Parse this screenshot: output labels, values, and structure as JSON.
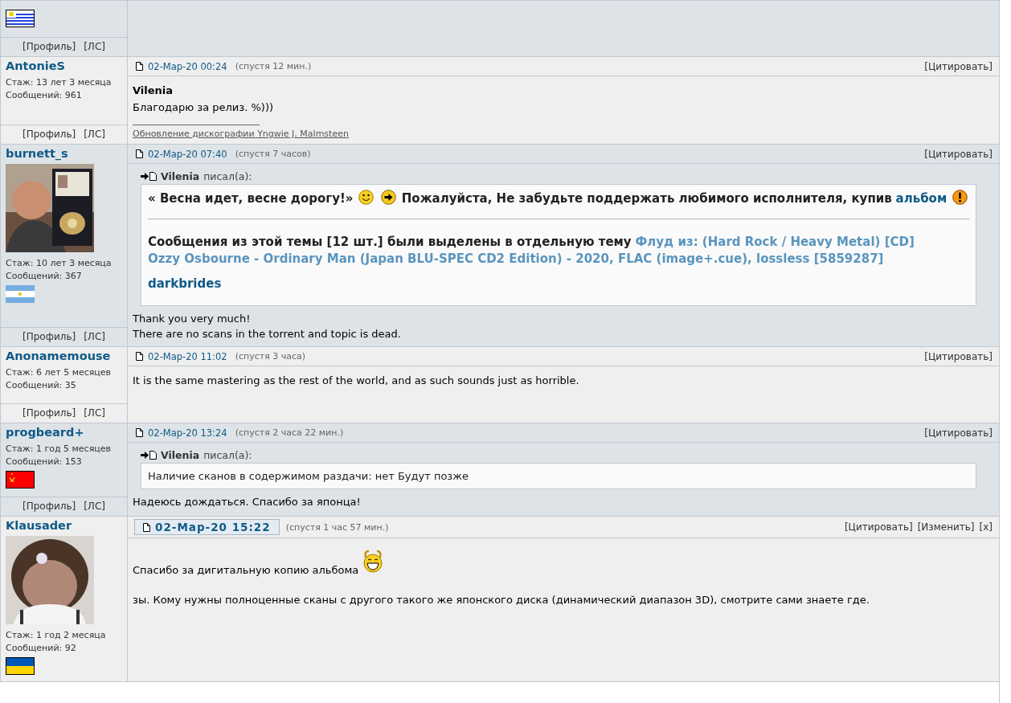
{
  "posts": [
    {
      "flag": {
        "kind": "uruguay"
      },
      "links": [
        "[Профиль]",
        "[ЛС]"
      ]
    },
    {
      "highlighted": false,
      "name": "AntonieS",
      "stats": [
        "Стаж: 13 лет 3 месяца",
        "Сообщений: 961"
      ],
      "links": [
        "[Профиль]",
        "[ЛС]"
      ],
      "date": "02-Мар-20 00:24",
      "after": "(спустя 12 мин.)",
      "actions": [
        "[Цитировать]"
      ],
      "body": [
        {
          "kind": "para",
          "parts": [
            {
              "kind": "strong",
              "text": "Vilenia"
            }
          ]
        },
        {
          "kind": "para",
          "parts": [
            {
              "kind": "text",
              "text": "Благодарю за релиз. %)))"
            }
          ]
        },
        {
          "kind": "signature",
          "text": "Обновление дискографии Yngwie J. Malmsteen"
        }
      ]
    },
    {
      "highlighted": false,
      "name": "burnett_s",
      "avatar": {
        "kind": "picture"
      },
      "stats": [
        "Стаж: 10 лет 3 месяца",
        "Сообщений: 367"
      ],
      "flag": {
        "kind": "argentina"
      },
      "links": [
        "[Профиль]",
        "[ЛС]"
      ],
      "date": "02-Мар-20 07:40",
      "after": "(спустя 7 часов)",
      "actions": [
        "[Цитировать]"
      ],
      "body": [
        {
          "kind": "quote",
          "author": "Vilenia",
          "wrote": "писал(а):",
          "blocks": [
            {
              "kind": "para",
              "parts": [
                {
                  "kind": "strong",
                  "text": "« Весна идет, весне дорогу!»"
                },
                {
                  "kind": "smiley"
                },
                {
                  "kind": "arrow"
                },
                {
                  "kind": "strong",
                  "text": "Пожалуйста, Не забудьте поддержать любимого исполнителя, купив"
                },
                {
                  "kind": "link",
                  "text": "альбом"
                },
                {
                  "kind": "warning"
                }
              ]
            },
            {
              "kind": "rule"
            },
            {
              "kind": "para",
              "parts": [
                {
                  "kind": "strong",
                  "text": "Сообщения из этой темы [12 шт.] были выделены в отдельную тему"
                },
                {
                  "kind": "topic",
                  "lines": [
                    "Флуд из: (Hard Rock / Heavy Metal) [CD]",
                    "Ozzy Osbourne - Ordinary Man (Japan BLU-SPEC CD2 Edition) - 2020, FLAC (image+.cue), lossless [5859287]"
                  ]
                }
              ]
            },
            {
              "kind": "para",
              "parts": [
                {
                  "kind": "link-strong",
                  "text": "darkbrides"
                }
              ]
            }
          ]
        },
        {
          "kind": "line",
          "parts": [
            {
              "kind": "text",
              "text": "Thank you very much!"
            }
          ]
        },
        {
          "kind": "line",
          "parts": [
            {
              "kind": "text",
              "text": "There are no scans in the torrent and topic is dead."
            }
          ]
        }
      ]
    },
    {
      "highlighted": false,
      "name": "Anonamemouse",
      "stats": [
        "Стаж: 6 лет 5 месяцев",
        "Сообщений: 35"
      ],
      "links": [
        "[Профиль]",
        "[ЛС]"
      ],
      "date": "02-Мар-20 11:02",
      "after": "(спустя 3 часа)",
      "actions": [
        "[Цитировать]"
      ],
      "body": [
        {
          "kind": "para",
          "parts": [
            {
              "kind": "text",
              "text": "It is the same mastering as the rest of the world, and as such sounds just as horrible."
            }
          ]
        }
      ]
    },
    {
      "highlighted": false,
      "name": "progbeard+",
      "stats": [
        "Стаж: 1 год 5 месяцев",
        "Сообщений: 153"
      ],
      "flag": {
        "kind": "ussr"
      },
      "links": [
        "[Профиль]",
        "[ЛС]"
      ],
      "date": "02-Мар-20 13:24",
      "after": "(спустя 2 часа 22 мин.)",
      "actions": [
        "[Цитировать]"
      ],
      "body": [
        {
          "kind": "quote",
          "author": "Vilenia",
          "wrote": "писал(а):",
          "blocks": [
            {
              "kind": "line",
              "parts": [
                {
                  "kind": "text",
                  "text": "Наличие сканов в содержимом раздачи: нет Будут позже"
                }
              ]
            }
          ]
        },
        {
          "kind": "para",
          "parts": [
            {
              "kind": "text",
              "text": "Надеюсь дождаться. Спасибо за японца!"
            }
          ]
        }
      ]
    },
    {
      "highlighted": true,
      "name": "Klausader",
      "avatar": {
        "kind": "picture"
      },
      "stats": [
        "Стаж: 1 год 2 месяца",
        "Сообщений: 92"
      ],
      "flag": {
        "kind": "ukraine"
      },
      "date": "02-Мар-20 15:22",
      "after": "(спустя 1 час 57 мин.)",
      "actions": [
        "[Цитировать]",
        "[Изменить]",
        "[x]"
      ],
      "body": [
        {
          "kind": "para",
          "parts": [
            {
              "kind": "text",
              "text": "Спасибо за дигитальную копию альбома"
            },
            {
              "kind": "grin"
            }
          ]
        },
        {
          "kind": "para",
          "parts": [
            {
              "kind": "text",
              "text": "зы. Кому нужны полноценные сканы с другого такого же японского диска (динамический диапазон 3D), смотрите сами знаете где."
            }
          ]
        }
      ]
    }
  ]
}
